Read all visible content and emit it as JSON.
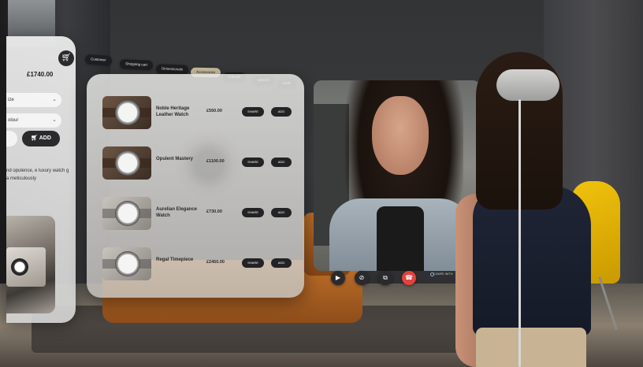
{
  "product": {
    "price": "£1740.00",
    "size_label": "ize",
    "colour_label": "olour",
    "add_label": "ADD",
    "description": "nd opulence, e luxury watch g a meticulously",
    "cart_icon": "cart-icon"
  },
  "tabs": [
    {
      "label": "Customer"
    },
    {
      "label": "Shopping cart"
    },
    {
      "label": "Dimensionals"
    },
    {
      "label": "Accessories",
      "active": true
    },
    {
      "label": "Follows"
    },
    {
      "label": "Search"
    },
    {
      "label": "Seek"
    }
  ],
  "catalog": {
    "items": [
      {
        "name": "Noble Heritage Leather Watch",
        "price": "£550.00",
        "share": "SHARE",
        "add": "ADD"
      },
      {
        "name": "Opulent Mastery",
        "price": "£1100.00",
        "share": "SHARE",
        "add": "ADD"
      },
      {
        "name": "Aurelian Elegance Watch",
        "price": "£730.00",
        "share": "SHARE",
        "add": "ADD"
      },
      {
        "name": "Regal Timepiece",
        "price": "£2450.00",
        "share": "SHARE",
        "add": "ADD"
      }
    ]
  },
  "call": {
    "brand": "COMPE WITH",
    "controls": [
      "video-icon",
      "mute-icon",
      "share-screen-icon",
      "end-call-icon"
    ],
    "end_color": "#e0453d"
  },
  "colors": {
    "accent_tab": "#c9bd9d",
    "button_dark": "#232325"
  }
}
